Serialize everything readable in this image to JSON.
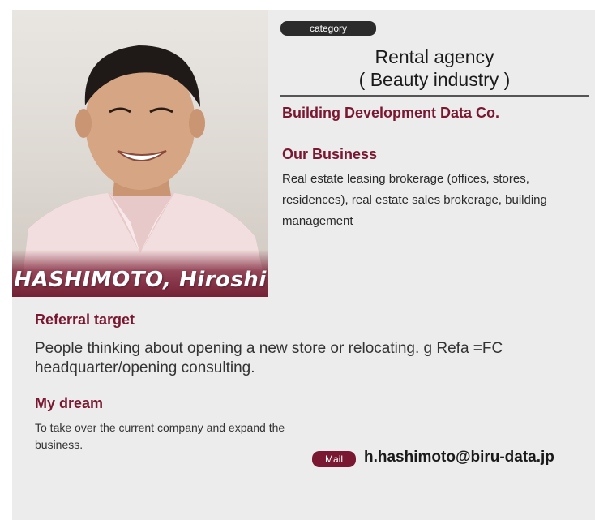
{
  "profile": {
    "name": "HASHIMOTO, Hiroshi",
    "category_label": "category",
    "agency_line1": "Rental agency",
    "agency_line2": "( Beauty industry )",
    "company": "Building Development Data Co."
  },
  "business": {
    "heading": "Our Business",
    "text": "Real estate leasing brokerage (offices, stores, residences), real estate sales brokerage, building management"
  },
  "referral": {
    "heading": "Referral target",
    "text": "People thinking about opening a new store or relocating. g Refa =FC headquarter/opening consulting."
  },
  "dream": {
    "heading": "My dream",
    "text": "To take over the current company and expand the business."
  },
  "contact": {
    "mail_label": "Mail",
    "email": "h.hashimoto@biru-data.jp"
  },
  "colors": {
    "accent": "#7a1832",
    "panel": "#ececec",
    "pill_dark": "#2b2b2b"
  }
}
